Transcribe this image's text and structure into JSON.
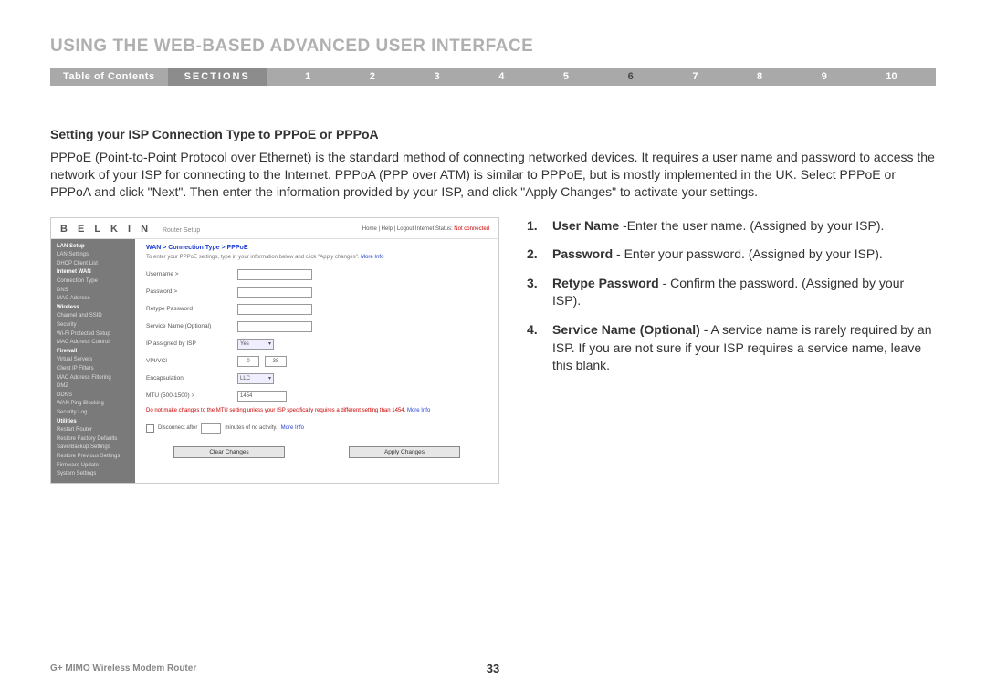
{
  "chapter_title": "USING THE WEB-BASED ADVANCED USER INTERFACE",
  "nav": {
    "toc": "Table of Contents",
    "sections": "SECTIONS",
    "numbers": [
      "1",
      "2",
      "3",
      "4",
      "5",
      "6",
      "7",
      "8",
      "9",
      "10"
    ],
    "active": "6"
  },
  "subheading": "Setting your ISP Connection Type to PPPoE or PPPoA",
  "body": "PPPoE (Point-to-Point Protocol over Ethernet) is the standard method of connecting networked devices. It requires a user name and password to access the network of your ISP for connecting to the Internet. PPPoA (PPP over ATM) is similar to PPPoE, but is mostly implemented in the UK. Select PPPoE or PPPoA and click \"Next\". Then enter the information provided by your ISP, and click \"Apply Changes\" to activate your settings.",
  "screenshot": {
    "logo": "B E L K I N",
    "logo_sub": "Router Setup",
    "top_links": "Home | Help | Logout   Internet Status:",
    "not_connected": "Not connected",
    "sidebar": [
      {
        "t": "LAN Setup",
        "h": true
      },
      {
        "t": "LAN Settings"
      },
      {
        "t": "DHCP Client List"
      },
      {
        "t": "Internet WAN",
        "h": true
      },
      {
        "t": "Connection Type"
      },
      {
        "t": "DNS"
      },
      {
        "t": "MAC Address"
      },
      {
        "t": "Wireless",
        "h": true
      },
      {
        "t": "Channel and SSID"
      },
      {
        "t": "Security"
      },
      {
        "t": "Wi-Fi Protected Setup"
      },
      {
        "t": "MAC Address Control"
      },
      {
        "t": "Firewall",
        "h": true
      },
      {
        "t": "Virtual Servers"
      },
      {
        "t": "Client IP Filters"
      },
      {
        "t": "MAC Address Filtering"
      },
      {
        "t": "DMZ"
      },
      {
        "t": "DDNS"
      },
      {
        "t": "WAN Ping Blocking"
      },
      {
        "t": "Security Log"
      },
      {
        "t": "Utilities",
        "h": true
      },
      {
        "t": "Restart Router"
      },
      {
        "t": "Restore Factory Defaults"
      },
      {
        "t": "Save/Backup Settings"
      },
      {
        "t": "Restore Previous Settings"
      },
      {
        "t": "Firmware Update"
      },
      {
        "t": "System Settings"
      }
    ],
    "breadcrumb": "WAN > Connection Type > PPPoE",
    "help": "To enter your PPPoE settings, type in your information below and click \"Apply changes\".",
    "more": "More Info",
    "labels": {
      "username": "Username >",
      "password": "Password >",
      "retype": "Retype Password",
      "service": "Service Name (Optional)",
      "ipassigned": "IP assigned by ISP",
      "vpivci": "VPI/VCI",
      "encap": "Encapsulation",
      "mtu": "MTU (500-1500) >"
    },
    "values": {
      "ipassigned": "Yes",
      "vpi": "0",
      "vci": "38",
      "encap": "LLC",
      "mtu": "1454"
    },
    "mtu_note": "Do not make changes to the MTU setting unless your ISP specifically requires a different setting than 1454.",
    "disconnect": {
      "pre": "Disconnect after",
      "post": "minutes of no activity.",
      "more": "More Info"
    },
    "buttons": {
      "clear": "Clear Changes",
      "apply": "Apply Changes"
    }
  },
  "instructions": [
    {
      "n": "1.",
      "b": "User Name",
      "t": " -Enter the user name. (Assigned by your ISP)."
    },
    {
      "n": "2.",
      "b": "Password",
      "t": " - Enter your password. (Assigned by your ISP)."
    },
    {
      "n": "3.",
      "b": "Retype Password",
      "t": " - Confirm the password. (Assigned by your ISP)."
    },
    {
      "n": "4.",
      "b": "Service Name (Optional)",
      "t": " - A service name is rarely required by an ISP. If you are not sure if your ISP requires a service name, leave this blank."
    }
  ],
  "footer": {
    "product": "G+ MIMO Wireless Modem Router",
    "page": "33"
  }
}
